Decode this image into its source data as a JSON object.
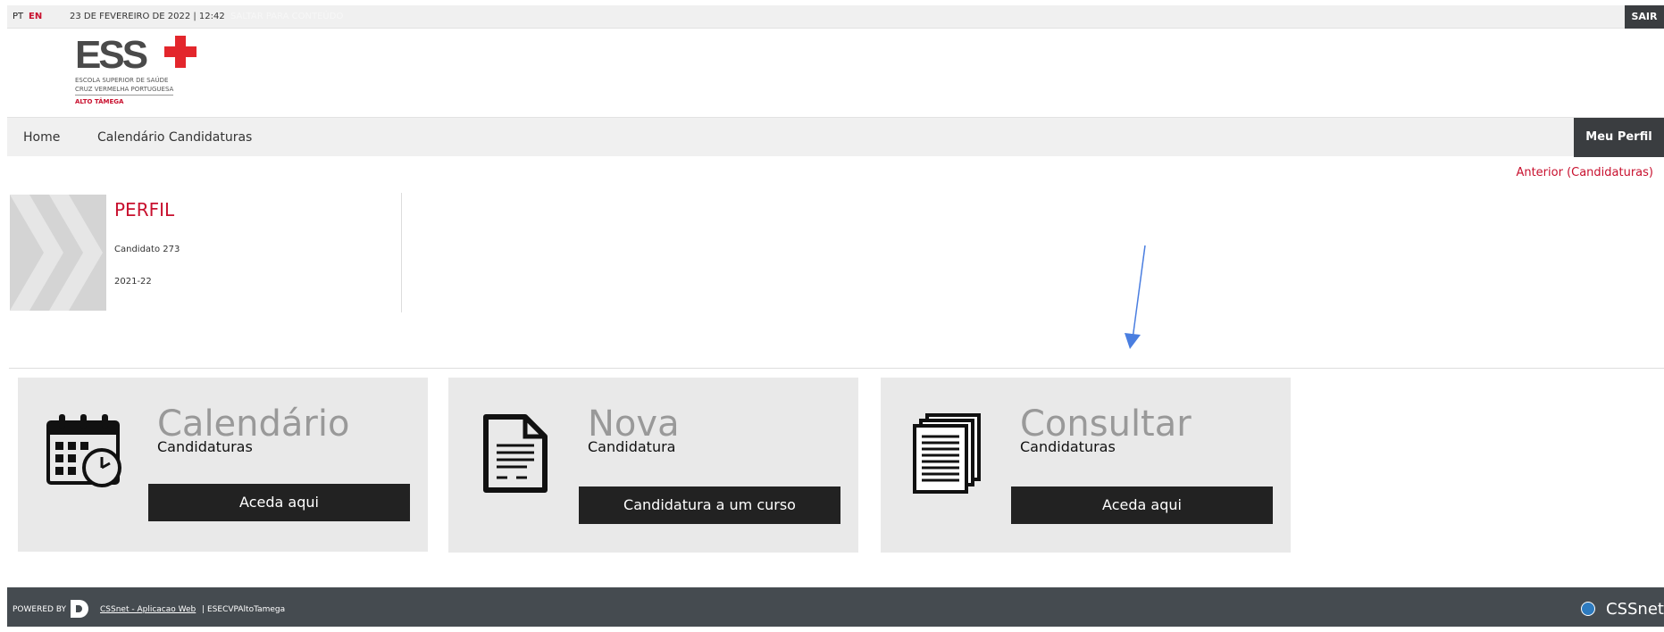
{
  "topbar": {
    "lang_pt": "PT",
    "lang_en": "EN",
    "datetime": "23 DE FEVEREIRO DE 2022 | 12:42",
    "skip_link": "SALTAR PARA CONTEÚDO",
    "logout": "SAIR"
  },
  "logo": {
    "mark": "ESS",
    "line1": "ESCOLA SUPERIOR DE SAÚDE",
    "line2": "CRUZ VERMELHA PORTUGUESA",
    "line3": "ALTO TÂMEGA"
  },
  "nav": {
    "home": "Home",
    "calendar": "Calendário Candidaturas",
    "profile": "Meu Perfil"
  },
  "back_link": "Anterior (Candidaturas)",
  "perfil": {
    "title": "PERFIL",
    "candidate": "Candidato 273",
    "year": "2021-22"
  },
  "cards": [
    {
      "big": "Calendário",
      "small": "Candidaturas",
      "button": "Aceda aqui",
      "icon": "calendar-clock-icon"
    },
    {
      "big": "Nova",
      "small": "Candidatura",
      "button": "Candidatura a um curso",
      "icon": "document-icon"
    },
    {
      "big": "Consultar",
      "small": "Candidaturas",
      "button": "Aceda aqui",
      "icon": "documents-stack-icon"
    }
  ],
  "footer": {
    "powered_by": "POWERED BY",
    "app_link": "CSSnet - Aplicacao Web",
    "separator": "|",
    "org": "ESECVPAltoTamega",
    "brand": "CSSnet"
  },
  "colors": {
    "accent_red": "#c8102e",
    "dark": "#222222",
    "card_bg": "#e9e9e9"
  }
}
